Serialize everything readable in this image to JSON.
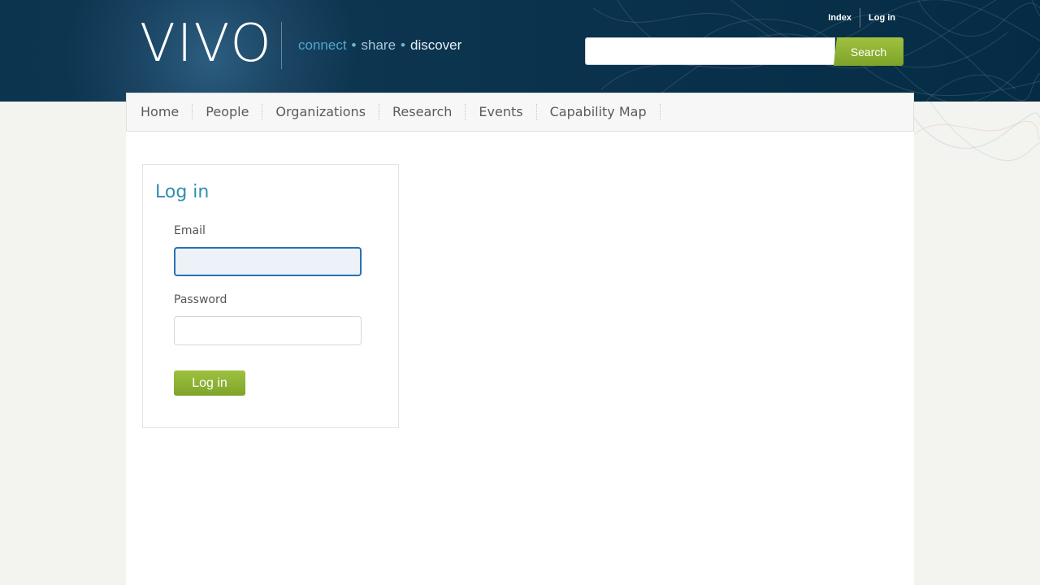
{
  "header": {
    "logo_text": "VIVO",
    "tagline": {
      "word1": "connect",
      "word2": "share",
      "word3": "discover",
      "separator": "•"
    },
    "top_links": [
      "Index",
      "Log in"
    ],
    "search": {
      "placeholder": "",
      "button_label": "Search"
    }
  },
  "nav": {
    "items": [
      {
        "label": "Home"
      },
      {
        "label": "People"
      },
      {
        "label": "Organizations"
      },
      {
        "label": "Research"
      },
      {
        "label": "Events"
      },
      {
        "label": "Capability Map"
      }
    ]
  },
  "login": {
    "title": "Log in",
    "email_label": "Email",
    "email_value": "",
    "password_label": "Password",
    "password_value": "",
    "submit_label": "Log in"
  },
  "colors": {
    "header_bg": "#062c45",
    "accent_green": "#8db536",
    "title_blue": "#2f8eb1",
    "focus_blue": "#2c6fb7"
  }
}
